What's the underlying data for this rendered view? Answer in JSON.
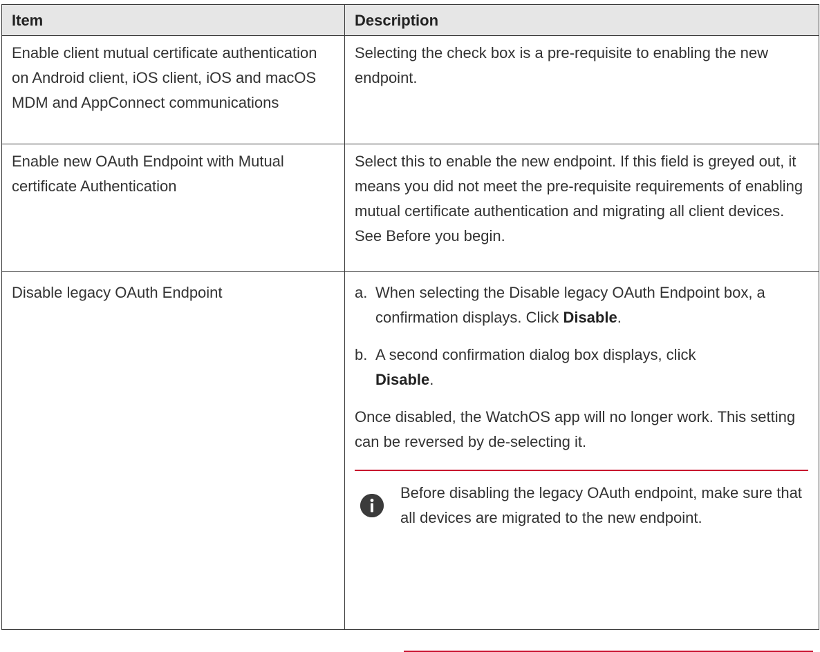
{
  "table": {
    "headers": [
      "Item",
      "Description"
    ],
    "rows": [
      {
        "item": "Enable client mutual certificate authentication on Android client, iOS client, iOS and macOS MDM and AppConnect communications",
        "description": "Selecting the check box is a pre-requisite to enabling the new endpoint."
      },
      {
        "item": "Enable new OAuth Endpoint with Mutual certificate Authentication",
        "description": "Select this to enable the new endpoint. If this field is greyed out, it means you did not meet the pre-requisite requirements of enabling mutual certificate authentication and migrating all client devices. See Before you begin."
      },
      {
        "item": "Disable legacy OAuth Endpoint",
        "steps": [
          {
            "letter": "a.",
            "text": "When selecting the Disable legacy OAuth Endpoint box, a confirmation displays. Click ",
            "bold": "Disable",
            "end": "."
          },
          {
            "letter": "b.",
            "text": "A second confirmation dialog box displays, click ",
            "bold": "Disable",
            "end": "."
          }
        ],
        "paragraph": "Once disabled, the WatchOS app will no longer work. This setting can be reversed by de-selecting it.",
        "note": {
          "icon": "info-icon",
          "text": "Before disabling the legacy OAuth endpoint, make sure that all devices are migrated to the new endpoint."
        }
      }
    ]
  },
  "colors": {
    "header_bg": "#e6e6e6",
    "note_rule": "#c8102e",
    "border": "#3a3a3a"
  }
}
